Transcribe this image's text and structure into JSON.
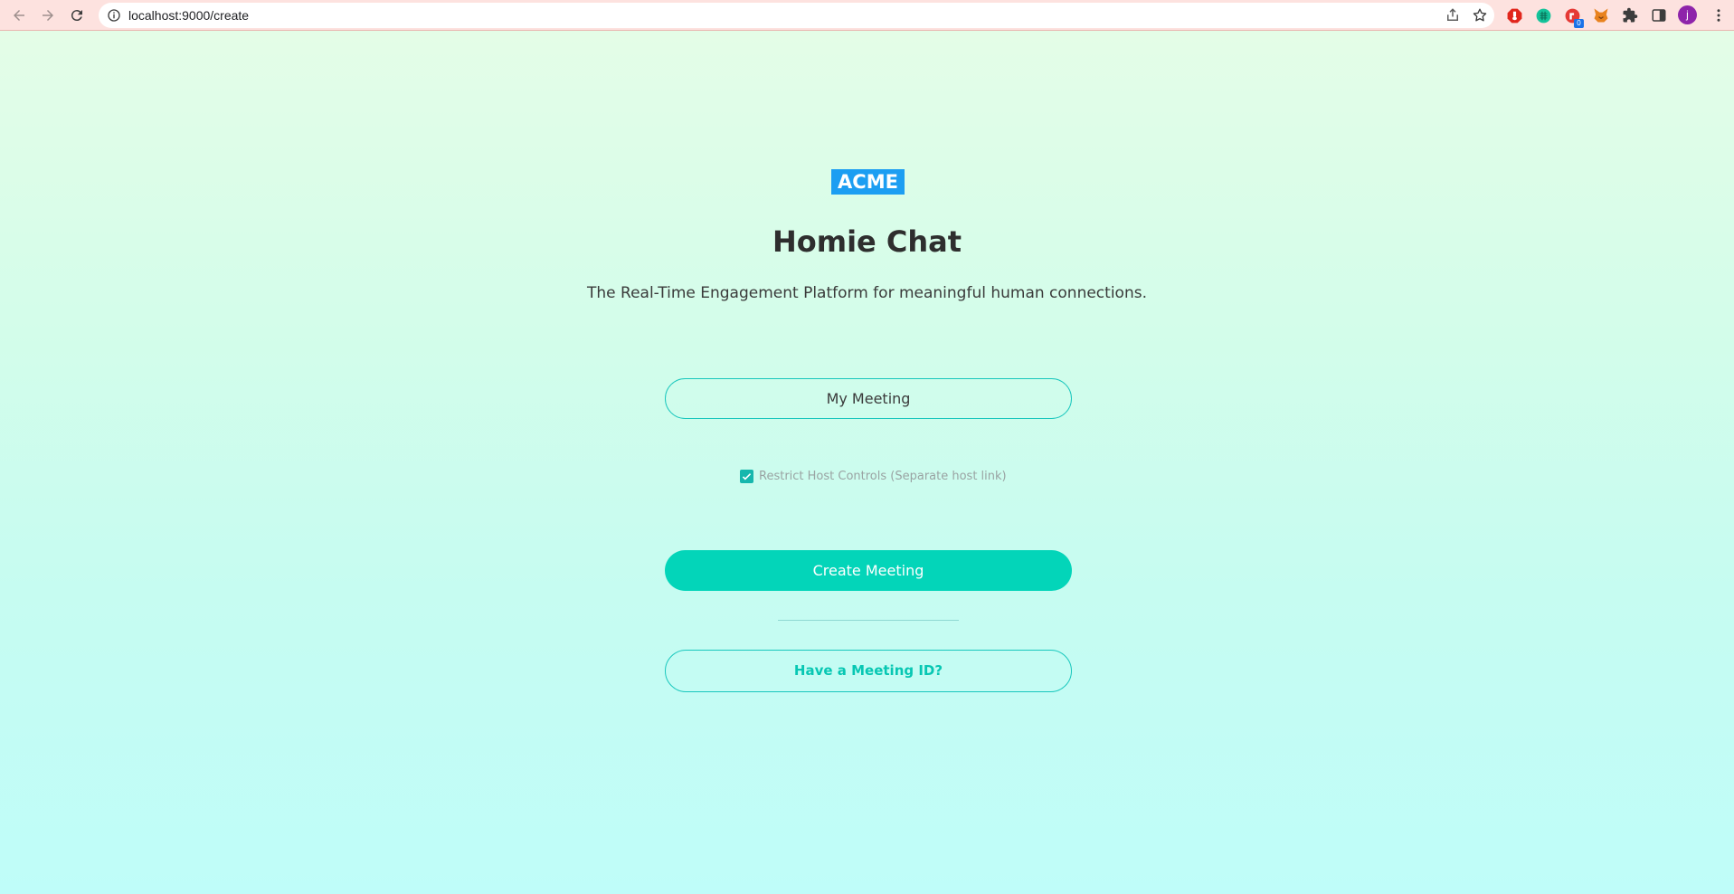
{
  "browser": {
    "url": "localhost:9000/create",
    "extension_badge": "0",
    "profile_initial": "j"
  },
  "page": {
    "logo_text": "ACME",
    "title": "Homie Chat",
    "subtitle": "The Real-Time Engagement Platform for meaningful human connections.",
    "meeting_name_value": "My Meeting",
    "restrict_host_label": "Restrict Host Controls (Separate host link)",
    "restrict_host_checked": true,
    "create_button_label": "Create Meeting",
    "have_id_button_label": "Have a Meeting ID?"
  },
  "colors": {
    "accent": "#03d5b9",
    "border": "#19c7bd",
    "logo_bg": "#1c9ef2",
    "toolbar_bg": "#fde2df"
  }
}
